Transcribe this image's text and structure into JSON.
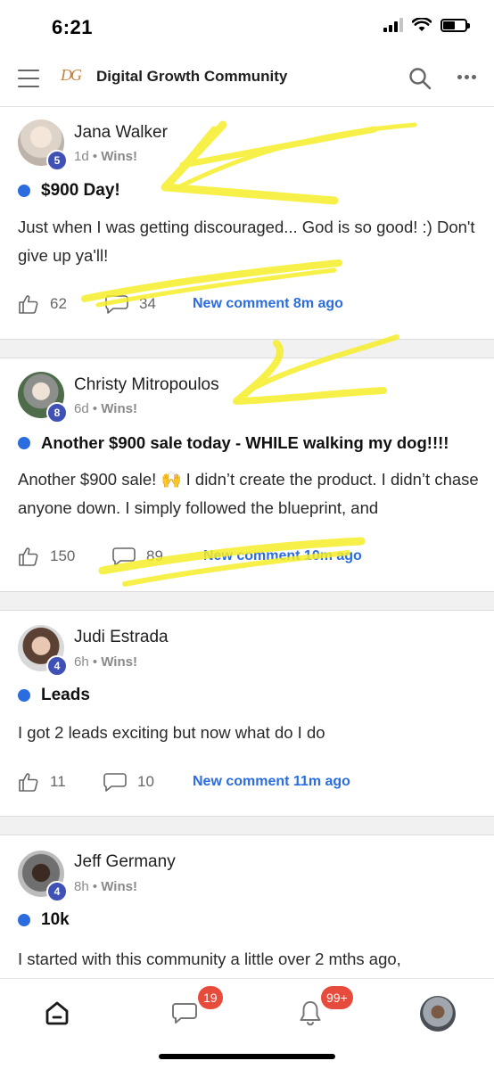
{
  "status_bar": {
    "time": "6:21"
  },
  "header": {
    "logo_text": "DG",
    "title": "Digital Growth Community"
  },
  "posts": [
    {
      "author": "Jana Walker",
      "level": "5",
      "age": "1d",
      "category": "Wins!",
      "title": "$900 Day!",
      "body": "Just when I was getting discouraged... God is so good! :) Don't give up ya'll!",
      "likes": "62",
      "comments": "34",
      "new_comment": "New comment 8m ago"
    },
    {
      "author": "Christy Mitropoulos",
      "level": "8",
      "age": "6d",
      "category": "Wins!",
      "title": "Another $900 sale today - WHILE walking my dog!!!!",
      "body": "Another $900 sale! 🙌 I didn’t create the product. I didn’t chase anyone down. I simply followed the blueprint, and",
      "likes": "150",
      "comments": "89",
      "new_comment": "New comment 10m ago"
    },
    {
      "author": "Judi Estrada",
      "level": "4",
      "age": "6h",
      "category": "Wins!",
      "title": "Leads",
      "body": "I got 2 leads exciting but now what do I do",
      "likes": "11",
      "comments": "10",
      "new_comment": "New comment 11m ago"
    },
    {
      "author": "Jeff Germany",
      "level": "4",
      "age": "8h",
      "category": "Wins!",
      "title": "10k",
      "body": "I started with this community a little over 2 mths ago,"
    }
  ],
  "bottom_nav": {
    "chat_badge": "19",
    "notifications_badge": "99+"
  },
  "colors": {
    "accent": "#2b6cde",
    "badge_red": "#e64b3b",
    "level_badge": "#3f51b5",
    "highlighter": "#f5ee2a"
  },
  "icons": [
    "menu-icon",
    "search-icon",
    "more-icon",
    "like-icon",
    "comment-icon",
    "home-icon",
    "chat-icon",
    "bell-icon"
  ]
}
